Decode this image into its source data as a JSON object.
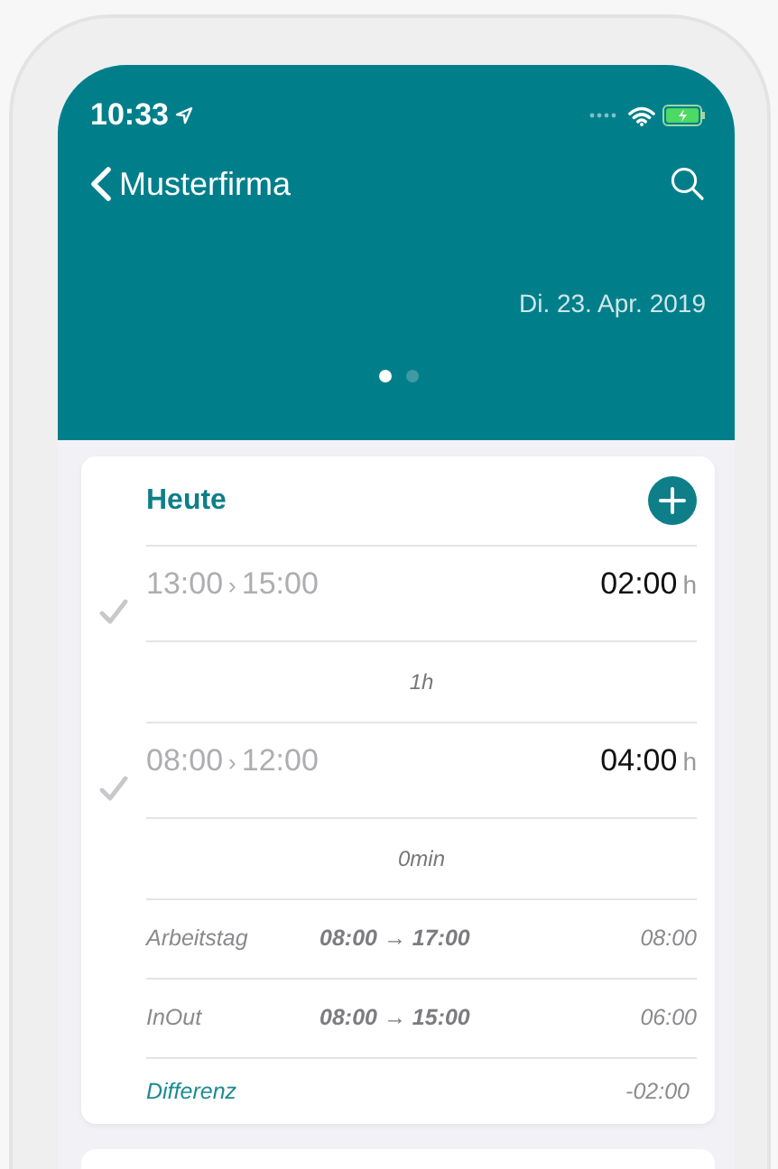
{
  "status_bar": {
    "time": "10:33"
  },
  "nav": {
    "back_label": "Musterfirma"
  },
  "header": {
    "date": "Di. 23. Apr. 2019",
    "pages": [
      {
        "selected": true
      },
      {
        "selected": false
      }
    ]
  },
  "day_card": {
    "title": "Heute",
    "items": [
      {
        "kind": "entry",
        "start": "13:00",
        "separator": "›",
        "end": "15:00",
        "duration": "02:00",
        "unit": "h",
        "checked": true
      },
      {
        "kind": "break",
        "text": "1h"
      },
      {
        "kind": "entry",
        "start": "08:00",
        "separator": "›",
        "end": "12:00",
        "duration": "04:00",
        "unit": "h",
        "checked": true
      },
      {
        "kind": "break",
        "text": "0min"
      }
    ],
    "summary": [
      {
        "kind": "row",
        "label": "Arbeitstag",
        "range": "08:00 → 17:00",
        "total": "08:00"
      },
      {
        "kind": "row",
        "label": "InOut",
        "range": "08:00 → 15:00",
        "total": "06:00"
      },
      {
        "kind": "diff",
        "label": "Differenz",
        "total": "-02:00"
      }
    ]
  }
}
